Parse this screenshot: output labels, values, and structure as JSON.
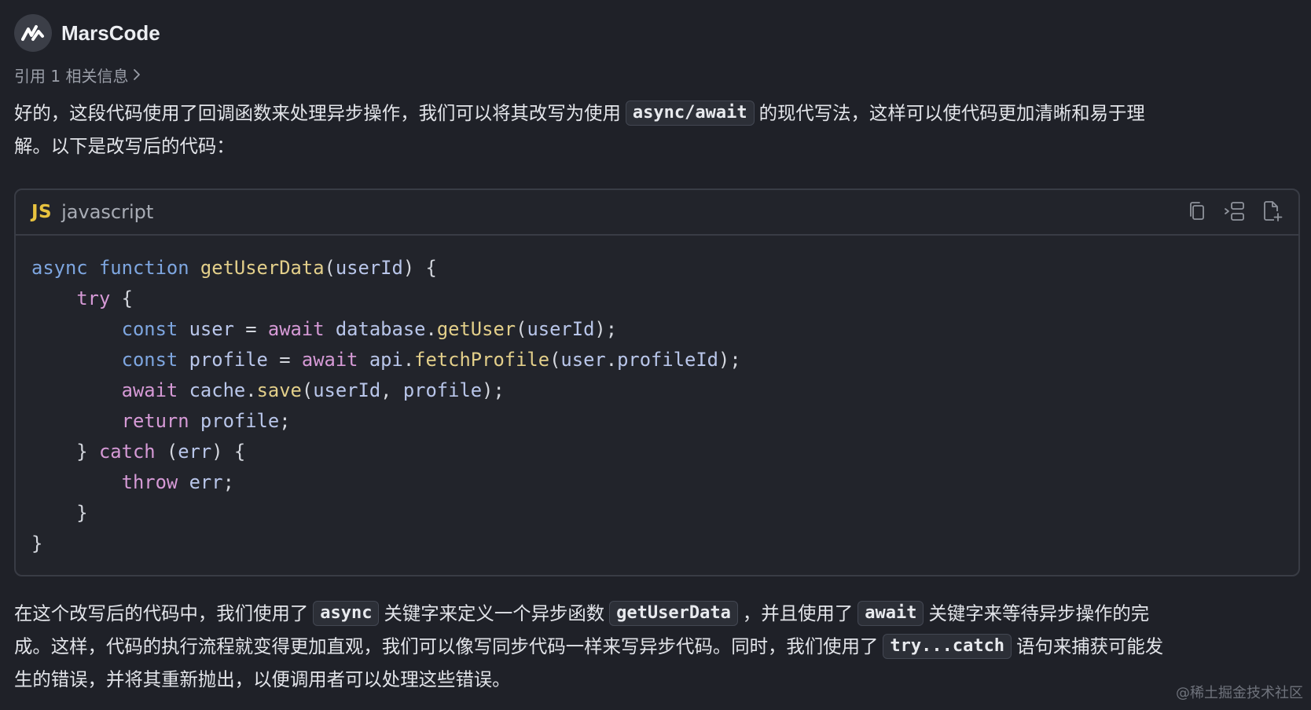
{
  "header": {
    "app_name": "MarsCode",
    "avatar_icon": "marscode-logo-icon"
  },
  "references": {
    "label": "引用 1 相关信息",
    "icon": "chevron-right-icon"
  },
  "intro": {
    "line1_before": "好的，这段代码使用了回调函数来处理异步操作，我们可以将其改写为使用",
    "line1_code": "async/await",
    "line1_after": "的现代写法，这样可以使代码更加清晰和易于理",
    "line2": "解。以下是改写后的代码："
  },
  "code_block": {
    "language_badge": "JS",
    "language": "javascript",
    "tools": [
      "copy-icon",
      "insert-icon",
      "new-file-icon"
    ],
    "lines": [
      [
        {
          "t": "async",
          "c": "kw"
        },
        {
          "t": " ",
          "c": "plain"
        },
        {
          "t": "function",
          "c": "kw"
        },
        {
          "t": " ",
          "c": "plain"
        },
        {
          "t": "getUserData",
          "c": "fn"
        },
        {
          "t": "(",
          "c": "plain"
        },
        {
          "t": "userId",
          "c": "var"
        },
        {
          "t": ") {",
          "c": "plain"
        }
      ],
      [
        {
          "t": "    ",
          "c": "plain"
        },
        {
          "t": "try",
          "c": "ctl"
        },
        {
          "t": " {",
          "c": "plain"
        }
      ],
      [
        {
          "t": "        ",
          "c": "plain"
        },
        {
          "t": "const",
          "c": "kw"
        },
        {
          "t": " ",
          "c": "plain"
        },
        {
          "t": "user",
          "c": "var"
        },
        {
          "t": " = ",
          "c": "plain"
        },
        {
          "t": "await",
          "c": "ctl"
        },
        {
          "t": " ",
          "c": "plain"
        },
        {
          "t": "database",
          "c": "var"
        },
        {
          "t": ".",
          "c": "plain"
        },
        {
          "t": "getUser",
          "c": "fn"
        },
        {
          "t": "(",
          "c": "plain"
        },
        {
          "t": "userId",
          "c": "var"
        },
        {
          "t": ");",
          "c": "plain"
        }
      ],
      [
        {
          "t": "        ",
          "c": "plain"
        },
        {
          "t": "const",
          "c": "kw"
        },
        {
          "t": " ",
          "c": "plain"
        },
        {
          "t": "profile",
          "c": "var"
        },
        {
          "t": " = ",
          "c": "plain"
        },
        {
          "t": "await",
          "c": "ctl"
        },
        {
          "t": " ",
          "c": "plain"
        },
        {
          "t": "api",
          "c": "var"
        },
        {
          "t": ".",
          "c": "plain"
        },
        {
          "t": "fetchProfile",
          "c": "fn"
        },
        {
          "t": "(",
          "c": "plain"
        },
        {
          "t": "user",
          "c": "var"
        },
        {
          "t": ".",
          "c": "plain"
        },
        {
          "t": "profileId",
          "c": "var"
        },
        {
          "t": ");",
          "c": "plain"
        }
      ],
      [
        {
          "t": "        ",
          "c": "plain"
        },
        {
          "t": "await",
          "c": "ctl"
        },
        {
          "t": " ",
          "c": "plain"
        },
        {
          "t": "cache",
          "c": "var"
        },
        {
          "t": ".",
          "c": "plain"
        },
        {
          "t": "save",
          "c": "fn"
        },
        {
          "t": "(",
          "c": "plain"
        },
        {
          "t": "userId",
          "c": "var"
        },
        {
          "t": ", ",
          "c": "plain"
        },
        {
          "t": "profile",
          "c": "var"
        },
        {
          "t": ");",
          "c": "plain"
        }
      ],
      [
        {
          "t": "        ",
          "c": "plain"
        },
        {
          "t": "return",
          "c": "ctl"
        },
        {
          "t": " ",
          "c": "plain"
        },
        {
          "t": "profile",
          "c": "var"
        },
        {
          "t": ";",
          "c": "plain"
        }
      ],
      [
        {
          "t": "    } ",
          "c": "plain"
        },
        {
          "t": "catch",
          "c": "ctl"
        },
        {
          "t": " (",
          "c": "plain"
        },
        {
          "t": "err",
          "c": "var"
        },
        {
          "t": ") {",
          "c": "plain"
        }
      ],
      [
        {
          "t": "        ",
          "c": "plain"
        },
        {
          "t": "throw",
          "c": "ctl"
        },
        {
          "t": " ",
          "c": "plain"
        },
        {
          "t": "err",
          "c": "var"
        },
        {
          "t": ";",
          "c": "plain"
        }
      ],
      [
        {
          "t": "    }",
          "c": "plain"
        }
      ],
      [
        {
          "t": "}",
          "c": "plain"
        }
      ]
    ]
  },
  "explanation": {
    "l1_a": "在这个改写后的代码中，我们使用了",
    "l1_code1": "async",
    "l1_b": "关键字来定义一个异步函数",
    "l1_code2": "getUserData",
    "l1_c": "，并且使用了",
    "l1_code3": "await",
    "l1_d": "关键字来等待异步操作的完",
    "l2_a": "成。这样，代码的执行流程就变得更加直观，我们可以像写同步代码一样来写异步代码。同时，我们使用了",
    "l2_code": "try...catch",
    "l2_b": "语句来捕获可能发",
    "l3": "生的错误，并将其重新抛出，以便调用者可以处理这些错误。"
  },
  "watermark": "@稀土掘金技术社区",
  "colors": {
    "background": "#1f2128",
    "keyword": "#7ea6e0",
    "function": "#e3cf8a",
    "control": "#d69ad6",
    "variable": "#b9c6ea",
    "js_badge": "#e8c33f"
  }
}
